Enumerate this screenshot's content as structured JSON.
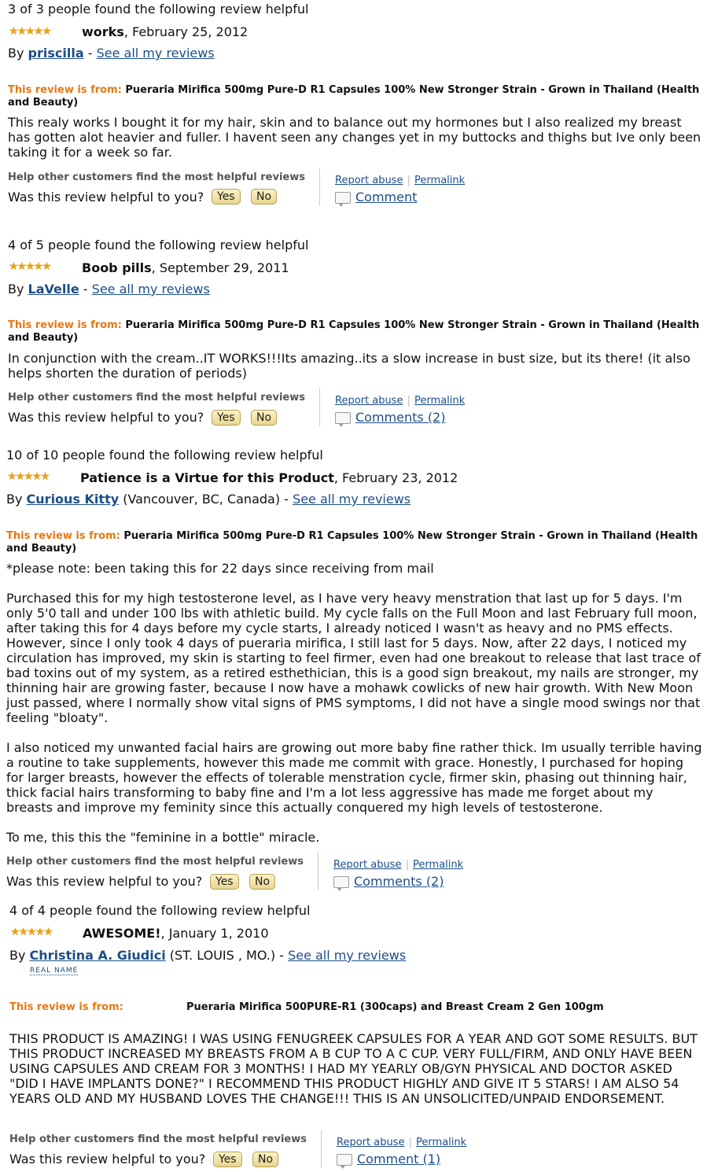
{
  "common": {
    "stars": "★★★★★",
    "by": "By",
    "dash": " - ",
    "see_all": "See all my reviews",
    "from_label": "This review is from:",
    "help_heading": "Help other customers find the most helpful reviews",
    "helpful_question": "Was this review helpful to you?",
    "yes": "Yes",
    "no": "No",
    "report_abuse": "Report abuse",
    "permalink": "Permalink",
    "pipe": "|",
    "real_name": "REAL NAME"
  },
  "reviews": [
    {
      "helpful_count": "3 of 3 people found the following review helpful",
      "title": "works",
      "date": ", February 25, 2012",
      "author": "priscilla",
      "location": "",
      "product": "Pueraria Mirifica 500mg Pure-D R1 Capsules 100% New Stronger Strain - Grown in Thailand (Health and Beauty)",
      "body": "This realy works I bought it for my hair, skin and to balance out my hormones but I also realized my breast has gotten alot heavier and fuller. I havent seen any changes yet in my buttocks and thighs but Ive only been taking it for a week so far.",
      "comments": "Comment"
    },
    {
      "helpful_count": "4 of 5 people found the following review helpful",
      "title": "Boob pills",
      "date": ", September 29, 2011",
      "author": "LaVelle",
      "location": "",
      "product": "Pueraria Mirifica 500mg Pure-D R1 Capsules 100% New Stronger Strain - Grown in Thailand (Health and Beauty)",
      "body": "In conjunction with the cream..IT WORKS!!!Its amazing..its a slow increase in bust size, but its there! (it also helps shorten the duration of periods)",
      "comments": "Comments (2)"
    },
    {
      "helpful_count": "10 of 10 people found the following review helpful",
      "title": "Patience is a Virtue for this Product",
      "date": ", February 23, 2012",
      "author": "Curious Kitty",
      "location": " (Vancouver, BC, Canada)",
      "product": "Pueraria Mirifica 500mg Pure-D R1 Capsules 100% New Stronger Strain - Grown in Thailand (Health and Beauty)",
      "body": "*please note: been taking this for 22 days since receiving from mail\n\nPurchased this for my high testosterone level, as I have very heavy menstration that last up for 5 days. I'm only 5'0 tall and under 100 lbs with athletic build. My cycle falls on the Full Moon and last February full moon, after taking this for 4 days before my cycle starts, I already noticed I wasn't as heavy and no PMS effects. However, since I only took 4 days of pueraria mirifica, I still last for 5 days. Now, after 22 days, I noticed my circulation has improved, my skin is starting to feel firmer, even had one breakout to release that last trace of bad toxins out of my system, as a retired esthethician, this is a good sign breakout, my nails are stronger, my thinning hair are growing faster, because I now have a mohawk cowlicks of new hair growth. With New Moon just passed, where I normally show vital signs of PMS symptoms, I did not have a single mood swings nor that feeling \"bloaty\".\n\nI also noticed my unwanted facial hairs are growing out more baby fine rather thick. Im usually terrible having a routine to take supplements, however this made me commit with grace. Honestly, I purchased for hoping for larger breasts, however the effects of tolerable menstration cycle, firmer skin, phasing out thinning hair, thick facial hairs transforming to baby fine and I'm a lot less aggressive has made me forget about my breasts and improve my feminity since this actually conquered my high levels of testosterone.\n\nTo me, this this the \"feminine in a bottle\" miracle.",
      "comments": "Comments (2)"
    },
    {
      "helpful_count": "4 of 4 people found the following review helpful",
      "title": "AWESOME!",
      "date": ", January 1, 2010",
      "author": "Christina A. Giudici",
      "location": " (ST. LOUIS , MO.)",
      "product": "Pueraria Mirifica 500PURE-R1 (300caps) and Breast Cream 2 Gen 100gm",
      "body": "THIS PRODUCT IS AMAZING! I WAS USING FENUGREEK CAPSULES FOR A YEAR AND GOT SOME RESULTS. BUT THIS PRODUCT INCREASED MY BREASTS FROM A B CUP TO A C CUP. VERY FULL/FIRM, AND ONLY HAVE BEEN USING CAPSULES AND CREAM FOR 3 MONTHS! I HAD MY YEARLY OB/GYN PHYSICAL AND DOCTOR ASKED \"DID I HAVE IMPLANTS DONE?\" I RECOMMEND THIS PRODUCT HIGHLY AND GIVE IT 5 STARS! I AM ALSO 54 YEARS OLD AND MY HUSBAND LOVES THE CHANGE!!! THIS IS AN UNSOLICITED/UNPAID ENDORSEMENT.",
      "comments": "Comment (1)"
    }
  ]
}
